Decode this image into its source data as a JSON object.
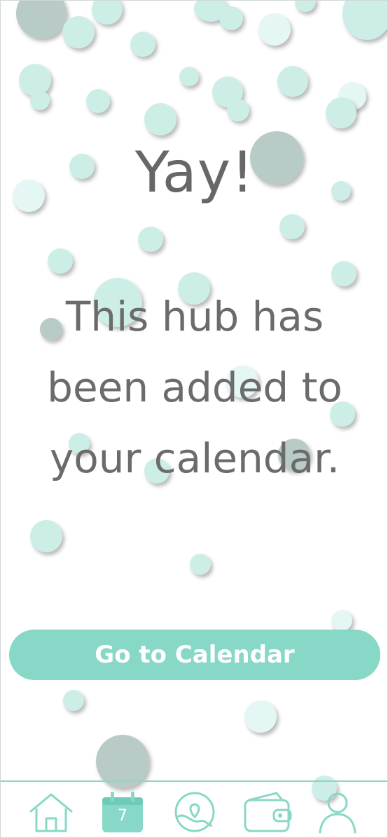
{
  "screen": {
    "headline": "Yay!",
    "message": "This hub has been added to your calendar."
  },
  "actions": {
    "go_to_calendar_label": "Go to Calendar"
  },
  "tabbar": {
    "calendar_day": "7",
    "items": [
      "home-icon",
      "calendar-icon",
      "map-pin-globe-icon",
      "wallet-icon",
      "profile-icon"
    ]
  },
  "colors": {
    "accent": "#88d8c7",
    "text": "#676767",
    "bubble_teal": "#cdeee7",
    "bubble_grey": "#a0b9b4"
  }
}
